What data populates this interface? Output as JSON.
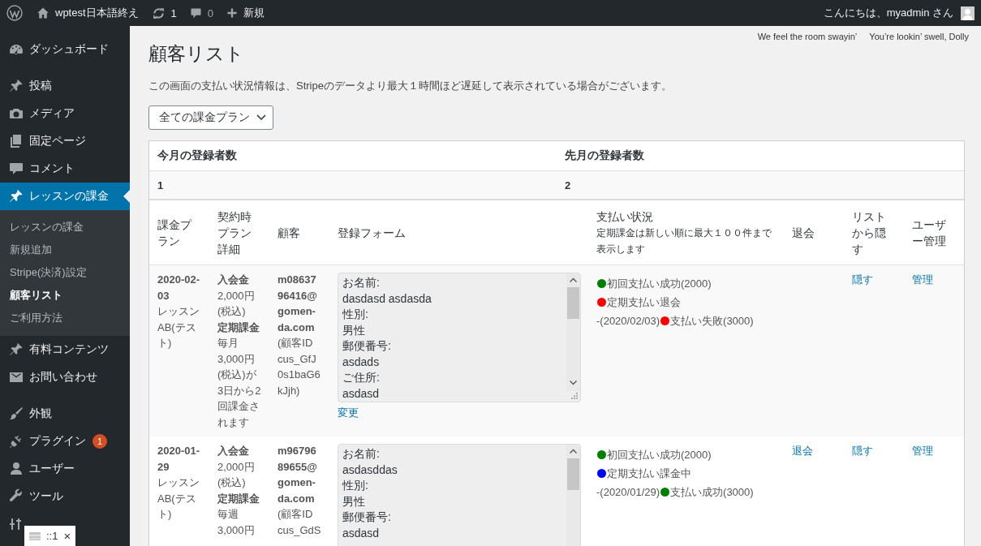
{
  "admin_bar": {
    "site_name": "wptest日本語終え",
    "updates": "1",
    "comments": "0",
    "new_label": "新規",
    "greeting": "こんにちは、myadmin さん"
  },
  "sidebar": {
    "groups": [
      [
        {
          "label": "ダッシュボード",
          "selected": false
        }
      ],
      [
        {
          "label": "投稿",
          "selected": false
        },
        {
          "label": "メディア",
          "selected": false
        },
        {
          "label": "固定ページ",
          "selected": false
        },
        {
          "label": "コメント",
          "selected": false
        },
        {
          "label": "レッスンの課金",
          "selected": true,
          "children": [
            {
              "label": "レッスンの課金",
              "selected": false
            },
            {
              "label": "新規追加",
              "selected": false
            },
            {
              "label": "Stripe(決済)設定",
              "selected": false
            },
            {
              "label": "顧客リスト",
              "selected": true
            },
            {
              "label": "ご利用方法",
              "selected": false
            }
          ]
        },
        {
          "label": "有料コンテンツ",
          "selected": false
        },
        {
          "label": "お問い合わせ",
          "selected": false
        }
      ],
      [
        {
          "label": "外観",
          "selected": false
        },
        {
          "label": "プラグイン",
          "selected": false,
          "badge": "1"
        },
        {
          "label": "ユーザー",
          "selected": false
        },
        {
          "label": "ツール",
          "selected": false
        },
        {
          "selected": false
        }
      ]
    ]
  },
  "lyrics": [
    "We feel the room swayin’",
    "You’re lookin’ swell, Dolly"
  ],
  "page_title": "顧客リスト",
  "notice": "この画面の支払い状況情報は、Stripeのデータより最大１時間ほど遅延して表示されている場合がございます。",
  "plan_filter": {
    "value": "全ての課金プラン"
  },
  "summary": {
    "columns": [
      "今月の登録者数",
      "先月の登録者数"
    ],
    "values": [
      "1",
      "2"
    ]
  },
  "table": {
    "columns": [
      {
        "label": "課金プラン"
      },
      {
        "label": "契約時プラン詳細"
      },
      {
        "label": "顧客"
      },
      {
        "label": "登録フォーム"
      },
      {
        "label": "支払い状況",
        "note": "定期課金は新しい順に最大１００件まで表示します"
      },
      {
        "label": "退会"
      },
      {
        "label": "リストから隠す"
      },
      {
        "label": "ユーザー管理"
      }
    ],
    "rows": [
      {
        "date": "2020-02-03",
        "plan": "レッスンAB(テスト)",
        "details": [
          {
            "label": "入会金",
            "text": "2,000円(税込)"
          },
          {
            "label": "定期課金",
            "text": "毎月3,000円(税込)が3日から2回課金されます"
          }
        ],
        "email": "m0863796416@gomen-da.com",
        "customer_id": "(顧客ID cus_GfJ0s1baG6kJjh)",
        "form_lines": [
          "お名前:",
          "dasdasd asdasda",
          "性別:",
          "男性",
          "郵便番号:",
          "asdads",
          "ご住所:",
          "asdasd"
        ],
        "edit_link": "変更",
        "payments": [
          {
            "color": "#008000",
            "text": "初回支払い成功(2000)"
          },
          {
            "color": "#ff0000",
            "text": "定期支払い退会"
          },
          {
            "prefix": "-(2020/02/03)",
            "color": "#ff0000",
            "text": "支払い失敗(3000)"
          }
        ],
        "hide_link": "隠す",
        "manage_link": "管理"
      },
      {
        "date": "2020-01-29",
        "plan": "レッスンAB(テスト)",
        "details": [
          {
            "label": "入会金",
            "text": "2,000円(税込)"
          },
          {
            "label": "定期課金",
            "text": "毎週 3,000円"
          }
        ],
        "email": "m9679689655@gomen-da.com",
        "customer_id": "(顧客ID cus_GdS",
        "form_lines": [
          "お名前:",
          "asdasddas",
          "性別:",
          "男性",
          "郵便番号:",
          "asdasd"
        ],
        "payments": [
          {
            "color": "#008000",
            "text": "初回支払い成功(2000)"
          },
          {
            "color": "#0000ff",
            "text": "定期支払い課金中"
          },
          {
            "prefix": "-(2020/01/29)",
            "color": "#008000",
            "text": "支払い成功(3000)"
          }
        ],
        "cancel_link": "退会",
        "hide_link": "隠す",
        "manage_link": "管理"
      }
    ]
  },
  "address_popup": {
    "text": "::1",
    "close": "×"
  }
}
